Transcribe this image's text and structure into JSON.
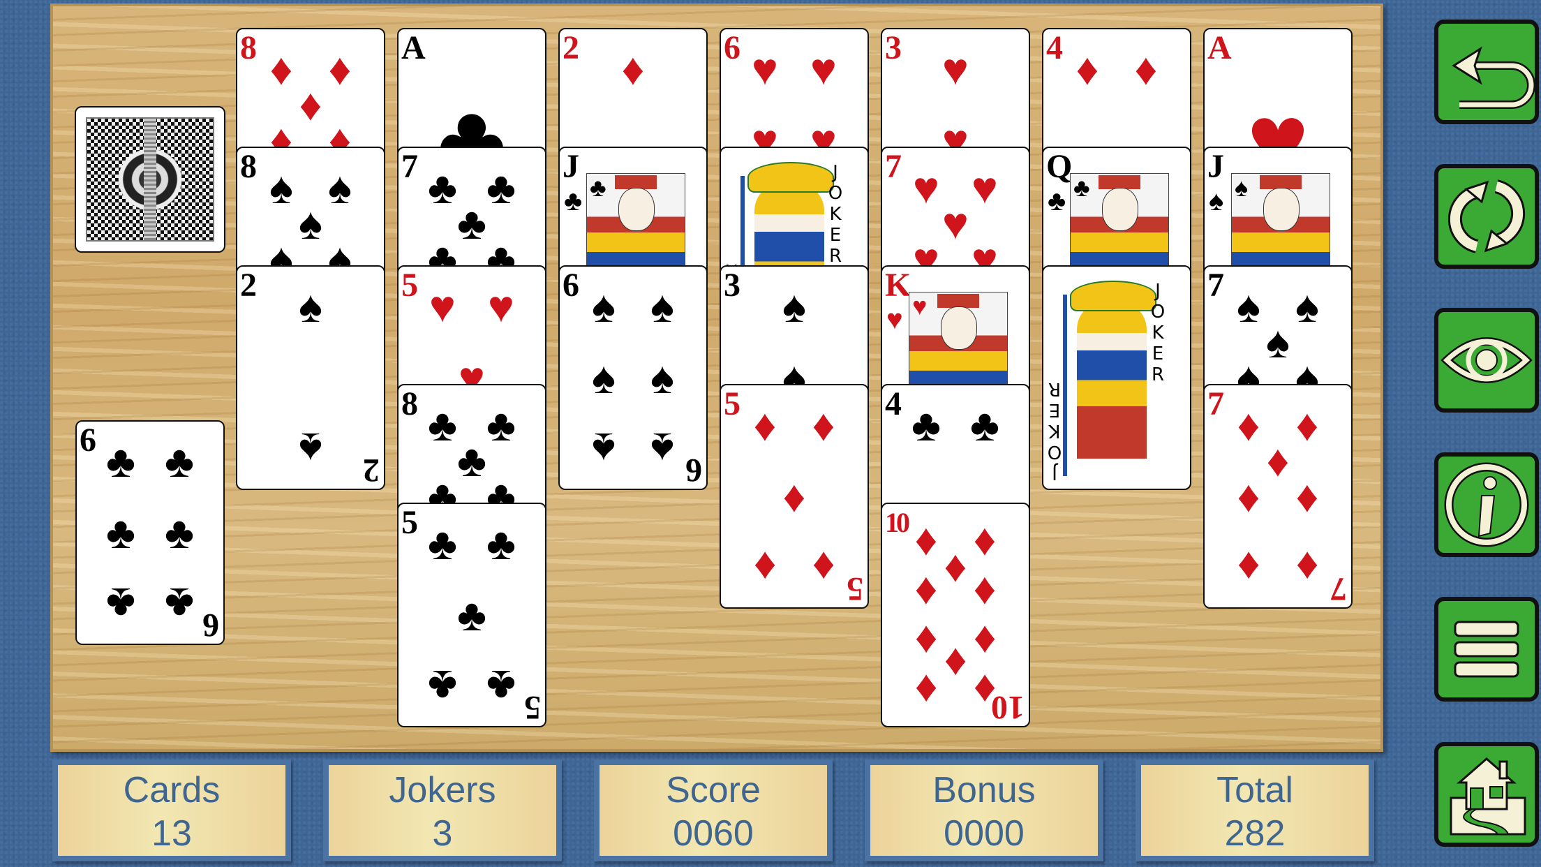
{
  "stock": {
    "label": "stock-pile",
    "face_down": true
  },
  "waste": {
    "rank": "6",
    "suit": "♣",
    "color": "black"
  },
  "tableau": [
    {
      "cards": [
        {
          "rank": "8",
          "suit": "♦",
          "color": "red"
        },
        {
          "rank": "8",
          "suit": "♠",
          "color": "black"
        },
        {
          "rank": "2",
          "suit": "♠",
          "color": "black"
        }
      ]
    },
    {
      "cards": [
        {
          "rank": "A",
          "suit": "♣",
          "color": "black"
        },
        {
          "rank": "7",
          "suit": "♣",
          "color": "black"
        },
        {
          "rank": "5",
          "suit": "♥",
          "color": "red"
        },
        {
          "rank": "8",
          "suit": "♣",
          "color": "black"
        },
        {
          "rank": "5",
          "suit": "♣",
          "color": "black"
        }
      ]
    },
    {
      "cards": [
        {
          "rank": "2",
          "suit": "♦",
          "color": "red"
        },
        {
          "rank": "J",
          "suit": "♣",
          "color": "black"
        },
        {
          "rank": "6",
          "suit": "♠",
          "color": "black"
        }
      ]
    },
    {
      "cards": [
        {
          "rank": "6",
          "suit": "♥",
          "color": "red"
        },
        {
          "rank": "JOKER",
          "suit": "",
          "color": "black"
        },
        {
          "rank": "3",
          "suit": "♠",
          "color": "black"
        },
        {
          "rank": "5",
          "suit": "♦",
          "color": "red"
        }
      ]
    },
    {
      "cards": [
        {
          "rank": "3",
          "suit": "♥",
          "color": "red"
        },
        {
          "rank": "7",
          "suit": "♥",
          "color": "red"
        },
        {
          "rank": "K",
          "suit": "♥",
          "color": "red"
        },
        {
          "rank": "4",
          "suit": "♣",
          "color": "black"
        },
        {
          "rank": "10",
          "suit": "♦",
          "color": "red"
        }
      ]
    },
    {
      "cards": [
        {
          "rank": "4",
          "suit": "♦",
          "color": "red"
        },
        {
          "rank": "Q",
          "suit": "♣",
          "color": "black"
        },
        {
          "rank": "JOKER",
          "suit": "",
          "color": "black"
        }
      ]
    },
    {
      "cards": [
        {
          "rank": "A",
          "suit": "♥",
          "color": "red"
        },
        {
          "rank": "J",
          "suit": "♠",
          "color": "black"
        },
        {
          "rank": "7",
          "suit": "♠",
          "color": "black"
        },
        {
          "rank": "7",
          "suit": "♦",
          "color": "red"
        }
      ]
    }
  ],
  "joker_text": "JOKER",
  "stats": [
    {
      "label": "Cards",
      "value": "13"
    },
    {
      "label": "Jokers",
      "value": "3"
    },
    {
      "label": "Score",
      "value": "0060"
    },
    {
      "label": "Bonus",
      "value": "0000"
    },
    {
      "label": "Total",
      "value": "282"
    }
  ],
  "side_buttons": [
    {
      "name": "undo",
      "icon": "undo-arrow-icon"
    },
    {
      "name": "restart",
      "icon": "refresh-icon"
    },
    {
      "name": "hint",
      "icon": "eye-icon"
    },
    {
      "name": "info",
      "icon": "info-icon"
    },
    {
      "name": "menu",
      "icon": "hamburger-menu-icon"
    },
    {
      "name": "home",
      "icon": "home-icon"
    }
  ],
  "colors": {
    "button_green": "#3aaa35",
    "panel_text": "#3e6690",
    "red_suit": "#d0141c"
  }
}
